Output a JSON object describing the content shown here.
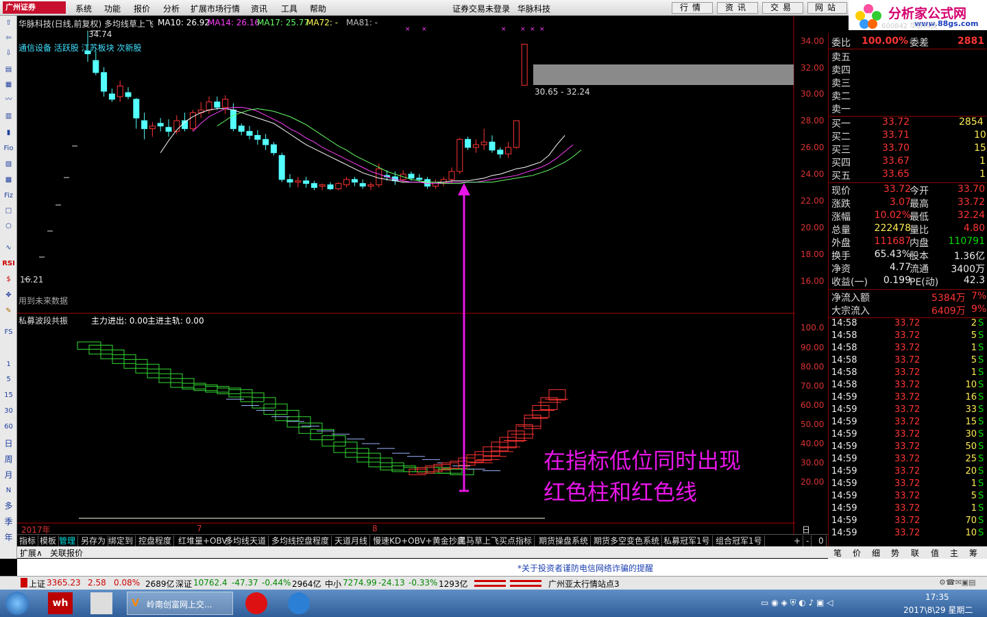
{
  "menubar": {
    "logo": "广州证券",
    "items": [
      "系统",
      "功能",
      "报价",
      "分析",
      "扩展市场行情",
      "资讯",
      "工具",
      "帮助"
    ],
    "center_status": "证券交易未登录",
    "center_stock": "华脉科技",
    "right_buttons": [
      "行情",
      "资讯",
      "交易",
      "网站"
    ]
  },
  "brand": {
    "title": "分析家公式网",
    "url": "www.88gs.com",
    "ghost": "600842 华脉科技"
  },
  "toolbar": {
    "icons": [
      "arrow-up-icon",
      "arrow-left-icon",
      "arrow-down-icon",
      "report-icon",
      "grid-icon",
      "line-chart-icon",
      "candle-icon",
      "bar-chart-icon",
      "fio-icon",
      "image-icon",
      "calc-icon",
      "fiz-icon",
      "square-icon",
      "circle-icon",
      "wave-icon",
      "rsi-icon",
      "dollar-icon",
      "move-icon",
      "pencil-icon"
    ],
    "labels": {
      "fio": "Fio",
      "fiz": "Fiz",
      "rsi": "RSI",
      "fs": "FS",
      "p1": "1",
      "p5": "5",
      "p15": "15",
      "p30": "30",
      "p60": "60",
      "day": "日",
      "week": "周",
      "month": "月",
      "n": "N",
      "multi": "多",
      "season": "季",
      "year": "年"
    }
  },
  "chart": {
    "header": {
      "title": "华脉科技(日线,前复权) 多均线草上飞",
      "ma10": "MA10: 26.92",
      "ma14": "MA14: 26.16",
      "ma17": "MA17: 25.77",
      "ma72": "MA72: -",
      "ma81": "MA81: -"
    },
    "tags": "通信设备 活跃股 江苏板块 次新股",
    "high_label": "34.74",
    "low_label": "16.21",
    "future_note": "用到未来数据",
    "range_label": "30.65 - 32.24",
    "price_ticks": [
      "34.00",
      "32.00",
      "30.00",
      "28.00",
      "26.00",
      "24.00",
      "22.00",
      "20.00",
      "18.00",
      "16.00"
    ],
    "indicator": {
      "name": "私募波段共振",
      "v1": "主力进出: 0.00",
      "v2": "主进主轨: 0.00",
      "ticks": [
        "100.0",
        "90.00",
        "80.00",
        "70.00",
        "60.00",
        "50.00",
        "40.00",
        "30.00",
        "20.00"
      ]
    },
    "date_labels": [
      "2017年",
      "7",
      "8"
    ],
    "period_label": "日线",
    "annotation_line1": "在指标低位同时出现",
    "annotation_line2": "红色柱和红色线",
    "colors": {
      "up": "#ff3434",
      "down": "#54ffff",
      "ma10": "#ffffff",
      "ma14": "#ff40ff",
      "ma17": "#66ff66",
      "ma72": "#ffff55",
      "arrow": "#e816e8"
    }
  },
  "chart_data": {
    "type": "candlestick",
    "title": "华脉科技(日线,前复权) 多均线草上飞",
    "ylim": [
      15.5,
      35.5
    ],
    "candles": [
      [
        33.2,
        34.74,
        32.4,
        33.0
      ],
      [
        32.5,
        33.2,
        31.4,
        31.6
      ],
      [
        31.6,
        32.0,
        29.8,
        30.2
      ],
      [
        30.0,
        30.4,
        29.4,
        29.6
      ],
      [
        29.8,
        31.0,
        29.4,
        30.6
      ],
      [
        30.1,
        30.5,
        29.6,
        29.8
      ],
      [
        29.6,
        29.7,
        27.4,
        28.2
      ],
      [
        28.0,
        28.6,
        26.6,
        27.4
      ],
      [
        27.4,
        27.9,
        26.8,
        27.6
      ],
      [
        27.8,
        28.2,
        27.2,
        27.6
      ],
      [
        27.5,
        28.1,
        26.8,
        27.2
      ],
      [
        27.2,
        28.4,
        27.0,
        28.0
      ],
      [
        28.0,
        28.6,
        27.2,
        27.4
      ],
      [
        27.4,
        28.8,
        27.2,
        28.6
      ],
      [
        28.6,
        29.4,
        28.2,
        28.8
      ],
      [
        28.8,
        29.8,
        28.5,
        29.4
      ],
      [
        29.4,
        29.8,
        28.8,
        29.0
      ],
      [
        29.0,
        29.9,
        28.5,
        29.6
      ],
      [
        28.8,
        29.3,
        27.2,
        27.4
      ],
      [
        27.6,
        27.8,
        26.9,
        27.2
      ],
      [
        27.2,
        27.6,
        26.6,
        26.9
      ],
      [
        26.9,
        27.3,
        26.2,
        26.6
      ],
      [
        26.6,
        27.0,
        25.8,
        26.2
      ],
      [
        26.2,
        26.4,
        25.4,
        25.6
      ],
      [
        25.4,
        25.6,
        23.4,
        23.6
      ],
      [
        23.6,
        24.0,
        23.0,
        23.4
      ],
      [
        23.4,
        23.8,
        23.0,
        23.5
      ],
      [
        23.5,
        23.8,
        23.0,
        23.3
      ],
      [
        23.3,
        23.5,
        22.8,
        23.0
      ],
      [
        23.1,
        23.3,
        22.8,
        23.2
      ],
      [
        23.2,
        23.4,
        22.8,
        22.9
      ],
      [
        22.9,
        23.4,
        22.8,
        23.3
      ],
      [
        23.2,
        23.8,
        23.0,
        23.6
      ],
      [
        23.6,
        23.8,
        23.1,
        23.4
      ],
      [
        23.3,
        23.6,
        22.9,
        23.1
      ],
      [
        23.1,
        23.4,
        22.8,
        23.2
      ],
      [
        23.2,
        24.8,
        23.0,
        24.4
      ],
      [
        23.9,
        24.3,
        23.5,
        23.8
      ],
      [
        23.8,
        24.2,
        23.2,
        23.5
      ],
      [
        23.6,
        24.3,
        23.4,
        24.0
      ],
      [
        24.0,
        24.2,
        23.5,
        23.7
      ],
      [
        23.7,
        24.0,
        23.4,
        23.6
      ],
      [
        23.6,
        23.8,
        22.9,
        23.1
      ],
      [
        23.1,
        23.6,
        22.9,
        23.4
      ],
      [
        23.4,
        23.8,
        23.1,
        23.6
      ],
      [
        23.6,
        24.5,
        23.3,
        24.2
      ],
      [
        24.2,
        26.7,
        24.0,
        26.6
      ],
      [
        26.6,
        26.8,
        25.8,
        26.0
      ],
      [
        26.0,
        26.6,
        25.6,
        26.2
      ],
      [
        26.2,
        27.4,
        25.8,
        26.4
      ],
      [
        26.4,
        26.9,
        25.6,
        25.8
      ],
      [
        25.8,
        26.0,
        25.2,
        25.5
      ],
      [
        25.5,
        26.4,
        25.2,
        26.0
      ],
      [
        26.0,
        28.0,
        25.9,
        28.0
      ],
      [
        30.65,
        33.72,
        30.65,
        33.72
      ]
    ],
    "ma_series": [
      {
        "name": "MA10",
        "start": 9,
        "values": [
          25.6,
          26.5,
          27.3,
          27.9,
          28.3,
          28.6,
          28.8,
          28.9,
          28.9,
          28.8,
          28.6,
          28.4,
          28.2,
          28.0,
          27.8,
          27.4,
          27.0,
          26.6,
          26.2,
          25.9,
          25.6,
          25.3,
          25.0,
          24.7,
          24.4,
          24.1,
          23.9,
          23.7,
          23.6,
          23.5,
          23.4,
          23.4,
          23.4,
          23.4,
          23.4,
          23.4,
          23.5,
          23.5,
          23.5,
          23.6,
          23.7,
          23.9,
          24.0,
          24.2,
          24.4,
          24.5,
          24.7,
          24.9,
          25.4,
          26.2,
          26.9
        ]
      },
      {
        "name": "MA14",
        "start": 13,
        "values": [
          27.2,
          27.8,
          28.3,
          28.6,
          28.9,
          29.0,
          29.0,
          28.9,
          28.7,
          28.4,
          28.1,
          27.8,
          27.4,
          27.1,
          26.7,
          26.4,
          26.0,
          25.7,
          25.4,
          25.1,
          24.8,
          24.5,
          24.2,
          24.0,
          23.8,
          23.6,
          23.5,
          23.4,
          23.4,
          23.3,
          23.3,
          23.3,
          23.4,
          23.4,
          23.4,
          23.4,
          23.5,
          23.6,
          23.7,
          23.8,
          23.9,
          24.1,
          24.3,
          24.5,
          24.8,
          25.2,
          25.7,
          26.2
        ]
      },
      {
        "name": "MA17",
        "start": 16,
        "values": [
          27.6,
          28.0,
          28.4,
          28.6,
          28.8,
          28.9,
          28.8,
          28.7,
          28.5,
          28.3,
          28.0,
          27.7,
          27.3,
          26.9,
          26.5,
          26.1,
          25.8,
          25.4,
          25.1,
          24.8,
          24.5,
          24.2,
          24.0,
          23.8,
          23.6,
          23.5,
          23.4,
          23.4,
          23.3,
          23.3,
          23.3,
          23.4,
          23.4,
          23.4,
          23.4,
          23.5,
          23.6,
          23.7,
          23.8,
          23.9,
          24.1,
          24.3,
          24.6,
          24.9,
          25.3,
          25.8
        ]
      }
    ],
    "indicator_series": {
      "name": "私募波段共振",
      "ylim": [
        0,
        110
      ],
      "green_steps": [
        98,
        96,
        93,
        90,
        87,
        84,
        81,
        78,
        75,
        72,
        71,
        70,
        69,
        68,
        66,
        63,
        59,
        55,
        51,
        47,
        43,
        39,
        35,
        31,
        28,
        25,
        22,
        20,
        19,
        19,
        19,
        18,
        18
      ],
      "blue_dashes": [
        62,
        58,
        55,
        51,
        48,
        45,
        42,
        40,
        37,
        34,
        31,
        28,
        26,
        24,
        22,
        20,
        18,
        17
      ],
      "red_steps": [
        18,
        19,
        20,
        21,
        22,
        23,
        25,
        27,
        29,
        32,
        35,
        38,
        42,
        46,
        52,
        58,
        63,
        68
      ],
      "red_dashes": [
        22,
        24,
        26,
        29,
        32,
        36,
        40,
        45,
        50,
        55,
        60,
        62
      ]
    }
  },
  "orderbook": {
    "wb": {
      "label": "委比",
      "value": "100.00%",
      "label2": "委差",
      "value2": "2881"
    },
    "sells": [
      {
        "label": "卖五"
      },
      {
        "label": "卖四"
      },
      {
        "label": "卖三"
      },
      {
        "label": "卖二"
      },
      {
        "label": "卖一"
      }
    ],
    "buys": [
      {
        "label": "买一",
        "price": "33.72",
        "vol": "2854"
      },
      {
        "label": "买二",
        "price": "33.71",
        "vol": "10"
      },
      {
        "label": "买三",
        "price": "33.70",
        "vol": "15"
      },
      {
        "label": "买四",
        "price": "33.67",
        "vol": "1"
      },
      {
        "label": "买五",
        "price": "33.65",
        "vol": "1"
      }
    ]
  },
  "quote": {
    "rows": [
      {
        "l1": "现价",
        "v1": "33.72",
        "l2": "今开",
        "v2": "33.70"
      },
      {
        "l1": "涨跌",
        "v1": "3.07",
        "l2": "最高",
        "v2": "33.72"
      },
      {
        "l1": "涨幅",
        "v1": "10.02%",
        "l2": "最低",
        "v2": "32.24"
      },
      {
        "l1": "总量",
        "v1": "222478",
        "l2": "量比",
        "v2": "4.80"
      },
      {
        "l1": "外盘",
        "v1": "111687",
        "l2": "内盘",
        "v2": "110791"
      },
      {
        "l1": "换手",
        "v1": "65.43%",
        "l2": "股本",
        "v2": "1.36亿"
      },
      {
        "l1": "净资",
        "v1": "4.77",
        "l2": "流通",
        "v2": "3400万"
      },
      {
        "l1": "收益(一)",
        "v1": "0.199",
        "l2": "PE(动)",
        "v2": "42.3"
      }
    ],
    "flow": [
      {
        "label": "净流入额",
        "value": "5384万",
        "pct": "7%"
      },
      {
        "label": "大宗流入",
        "value": "6409万",
        "pct": "9%"
      }
    ]
  },
  "ticks": [
    {
      "t": "14:58",
      "p": "33.72",
      "v": "2",
      "s": "S"
    },
    {
      "t": "14:58",
      "p": "33.72",
      "v": "5",
      "s": "S"
    },
    {
      "t": "14:58",
      "p": "33.72",
      "v": "1",
      "s": "S"
    },
    {
      "t": "14:58",
      "p": "33.72",
      "v": "5",
      "s": "S"
    },
    {
      "t": "14:58",
      "p": "33.72",
      "v": "1",
      "s": "S"
    },
    {
      "t": "14:58",
      "p": "33.72",
      "v": "10",
      "s": "S"
    },
    {
      "t": "14:59",
      "p": "33.72",
      "v": "16",
      "s": "S"
    },
    {
      "t": "14:59",
      "p": "33.72",
      "v": "33",
      "s": "S"
    },
    {
      "t": "14:59",
      "p": "33.72",
      "v": "15",
      "s": "S"
    },
    {
      "t": "14:59",
      "p": "33.72",
      "v": "30",
      "s": "S"
    },
    {
      "t": "14:59",
      "p": "33.72",
      "v": "50",
      "s": "S"
    },
    {
      "t": "14:59",
      "p": "33.72",
      "v": "25",
      "s": "S"
    },
    {
      "t": "14:59",
      "p": "33.72",
      "v": "20",
      "s": "S"
    },
    {
      "t": "14:59",
      "p": "33.72",
      "v": "1",
      "s": "S"
    },
    {
      "t": "14:59",
      "p": "33.72",
      "v": "5",
      "s": "S"
    },
    {
      "t": "14:59",
      "p": "33.72",
      "v": "1",
      "s": "S"
    },
    {
      "t": "14:59",
      "p": "33.72",
      "v": "70",
      "s": "S"
    },
    {
      "t": "14:59",
      "p": "33.72",
      "v": "10",
      "s": "S"
    }
  ],
  "bottom_tabs": [
    "笔",
    "价",
    "细",
    "势",
    "联",
    "值",
    "主",
    "筹"
  ],
  "indicator_tabs": [
    "指标",
    "模板",
    "管理",
    "另存为",
    "绑定到",
    "控盘程度",
    "红堆量+OBV",
    "多均线天道",
    "多均线控盘程度",
    "天道月线",
    "慢速KD+OBV+黄金抄底",
    "黑马草上飞买点指标",
    "期货操盘系统",
    "期货多空变色系统",
    "私募冠军1号",
    "组合冠军1号"
  ],
  "tab_controls": [
    "+",
    "-",
    "0"
  ],
  "extbar": {
    "expand": "扩展∧",
    "related": "关联报价"
  },
  "notice": "*关于投资者谨防电信网络诈骗的提醒",
  "statusbar": {
    "sh_label": "上证",
    "sh_value": "3365.23",
    "sh_chg": "2.58",
    "sh_pct": "0.08%",
    "sh_amt": "2689亿",
    "sz_label": "深证",
    "sz_value": "10762.4",
    "sz_chg": "-47.37",
    "sz_pct": "-0.44%",
    "sz_amt": "2964亿",
    "zx_label": "中小",
    "zx_value": "7274.99",
    "zx_chg": "-24.13",
    "zx_pct": "-0.33%",
    "zx_amt": "1293亿",
    "station": "广州亚太行情站点3"
  },
  "taskbar": {
    "app_title": "岭南创富网上交...",
    "time": "17:35",
    "date": "2017\\8\\29 星期二"
  }
}
